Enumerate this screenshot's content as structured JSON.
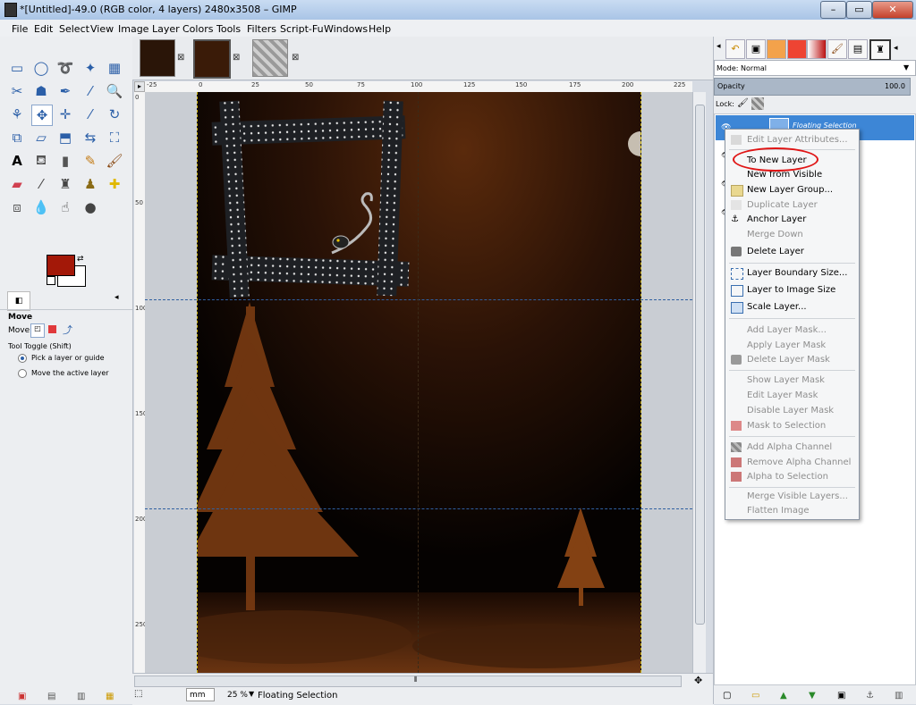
{
  "window": {
    "title": "*[Untitled]-49.0 (RGB color, 4 layers) 2480x3508 – GIMP",
    "min": "–",
    "max": "▭",
    "close": "✕"
  },
  "menubar": [
    "File",
    "Edit",
    "Select",
    "View",
    "Image",
    "Layer",
    "Colors",
    "Tools",
    "Filters",
    "Script-Fu",
    "Windows",
    "Help"
  ],
  "toolbox": {
    "tools": [
      "rect-select",
      "ellipse-select",
      "free-select",
      "fuzzy-select",
      "scissors",
      "foreground-select",
      "paths",
      "color-picker",
      "zoom",
      "measure",
      "move",
      "align",
      "crop",
      "rotate",
      "scale",
      "shear",
      "perspective",
      "flip",
      "cage",
      "text",
      "smudge-bucket",
      "blend",
      "pencil",
      "paintbrush",
      "eraser",
      "airbrush",
      "ink",
      "clone",
      "heal",
      "dodge",
      "blur",
      "smudge2",
      "dodge-burn"
    ],
    "fg_color": "#a31808",
    "bg_color": "#ffffff"
  },
  "tool_options": {
    "title": "Move",
    "move_label": "Move:",
    "toggle_label": "Tool Toggle  (Shift)",
    "opt1": "Pick a layer or guide",
    "opt2": "Move the active layer"
  },
  "ruler_h": [
    "-25",
    "0",
    "25",
    "50",
    "75",
    "100",
    "125",
    "150",
    "175",
    "200",
    "225"
  ],
  "ruler_v": [
    "0",
    "50",
    "100",
    "150",
    "200",
    "250"
  ],
  "statusbar": {
    "unit": "mm",
    "zoom": "25 %",
    "message": "Floating Selection"
  },
  "layers_panel": {
    "mode_label": "Mode: Normal",
    "opacity_label": "Opacity",
    "opacity_value": "100.0",
    "lock_label": "Lock:",
    "active_layer": "Floating Selection"
  },
  "context_menu": {
    "items": [
      {
        "label": "Edit Layer Attributes...",
        "enabled": false
      },
      {
        "label": "To New Layer",
        "enabled": true
      },
      {
        "label": "New from Visible",
        "enabled": true
      },
      {
        "label": "New Layer Group...",
        "enabled": true
      },
      {
        "label": "Duplicate Layer",
        "enabled": false
      },
      {
        "label": "Anchor Layer",
        "enabled": true
      },
      {
        "label": "Merge Down",
        "enabled": false
      },
      {
        "label": "Delete Layer",
        "enabled": true
      },
      {
        "label": "Layer Boundary Size...",
        "enabled": true
      },
      {
        "label": "Layer to Image Size",
        "enabled": true
      },
      {
        "label": "Scale Layer...",
        "enabled": true
      },
      {
        "label": "Add Layer Mask...",
        "enabled": false
      },
      {
        "label": "Apply Layer Mask",
        "enabled": false
      },
      {
        "label": "Delete Layer Mask",
        "enabled": false
      },
      {
        "label": "Show Layer Mask",
        "enabled": false
      },
      {
        "label": "Edit Layer Mask",
        "enabled": false
      },
      {
        "label": "Disable Layer Mask",
        "enabled": false
      },
      {
        "label": "Mask to Selection",
        "enabled": false
      },
      {
        "label": "Add Alpha Channel",
        "enabled": false
      },
      {
        "label": "Remove Alpha Channel",
        "enabled": false
      },
      {
        "label": "Alpha to Selection",
        "enabled": false
      },
      {
        "label": "Merge Visible Layers...",
        "enabled": false
      },
      {
        "label": "Flatten Image",
        "enabled": false
      }
    ],
    "highlight_color": "#e01515"
  }
}
